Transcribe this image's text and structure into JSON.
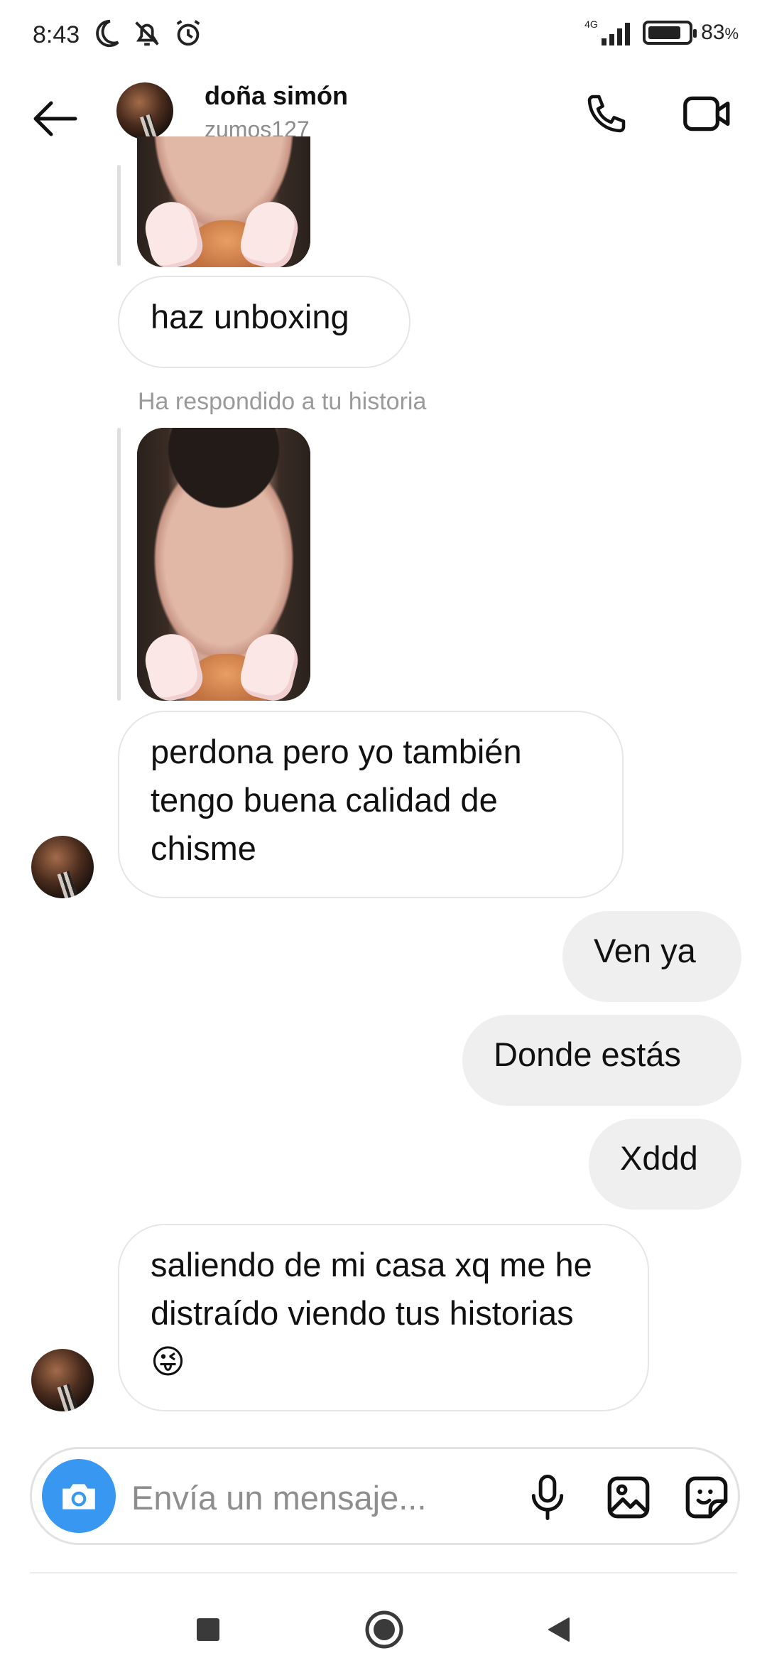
{
  "status_bar": {
    "time": "8:43",
    "network": "4G",
    "battery_percent": "83",
    "battery_unit": "%",
    "battery_level": 0.83
  },
  "header": {
    "name": "doña simón",
    "username": "zumos127"
  },
  "messages": {
    "m1": "haz unboxing",
    "story_reply_label": "Ha respondido a tu historia",
    "m2": "perdona pero yo también tengo buena calidad de chisme",
    "m3": "Ven ya",
    "m4": "Donde estás",
    "m5": "Xddd",
    "m6": "saliendo de mi casa xq me he distraído viendo tus historias",
    "m6_emoji": "😜"
  },
  "composer": {
    "placeholder": "Envía un mensaje..."
  },
  "icons": {
    "back": "arrow-left-icon",
    "call": "phone-icon",
    "video": "video-camera-icon",
    "camera": "camera-icon",
    "mic": "microphone-icon",
    "gallery": "image-icon",
    "sticker": "sticker-icon"
  },
  "colors": {
    "accent": "#3897f0",
    "incoming_border": "#e6e6e6",
    "outgoing_bg": "#efefef"
  }
}
